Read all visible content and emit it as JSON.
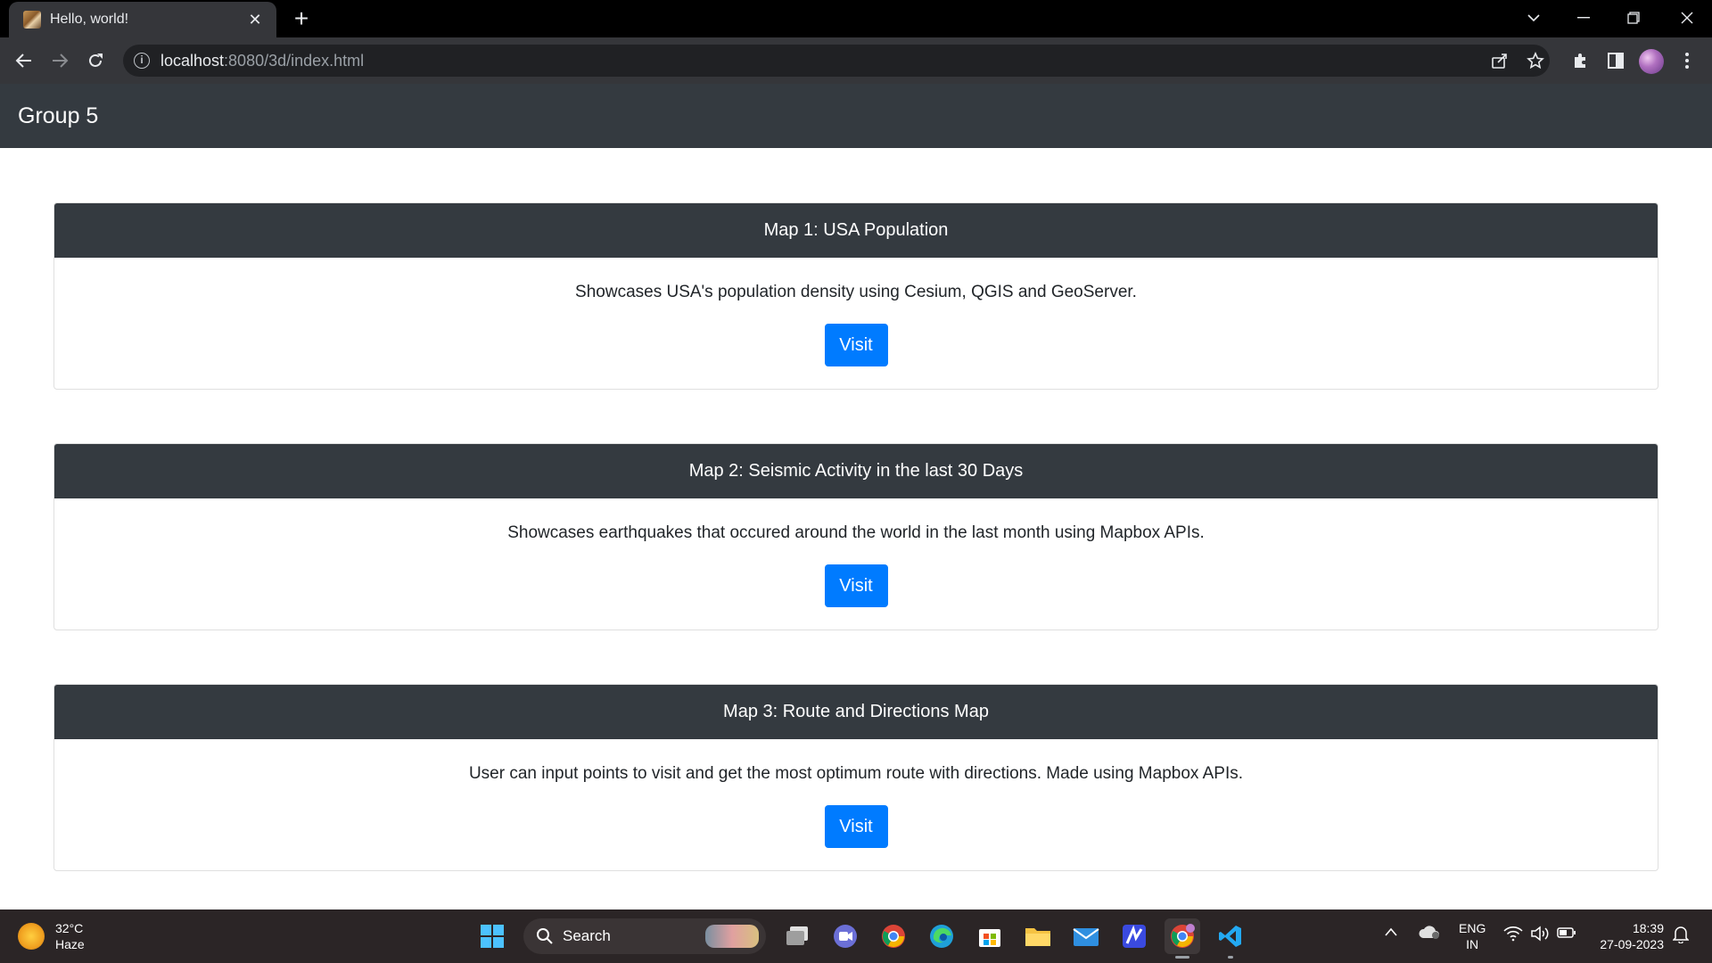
{
  "browser": {
    "tab_title": "Hello, world!",
    "url_host": "localhost",
    "url_path": ":8080/3d/index.html"
  },
  "page": {
    "brand": "Group 5",
    "cards": [
      {
        "title": "Map 1: USA Population",
        "text": "Showcases USA's population density using Cesium, QGIS and GeoServer.",
        "button": "Visit"
      },
      {
        "title": "Map 2: Seismic Activity in the last 30 Days",
        "text": "Showcases earthquakes that occured around the world in the last month using Mapbox APIs.",
        "button": "Visit"
      },
      {
        "title": "Map 3: Route and Directions Map",
        "text": "User can input points to visit and get the most optimum route with directions. Made using Mapbox APIs.",
        "button": "Visit"
      }
    ]
  },
  "taskbar": {
    "weather_temp": "32°C",
    "weather_desc": "Haze",
    "search_label": "Search",
    "lang_top": "ENG",
    "lang_bottom": "IN",
    "time": "18:39",
    "date": "27-09-2023"
  },
  "colors": {
    "navbar_bg": "#343a40",
    "button_bg": "#007bff"
  }
}
